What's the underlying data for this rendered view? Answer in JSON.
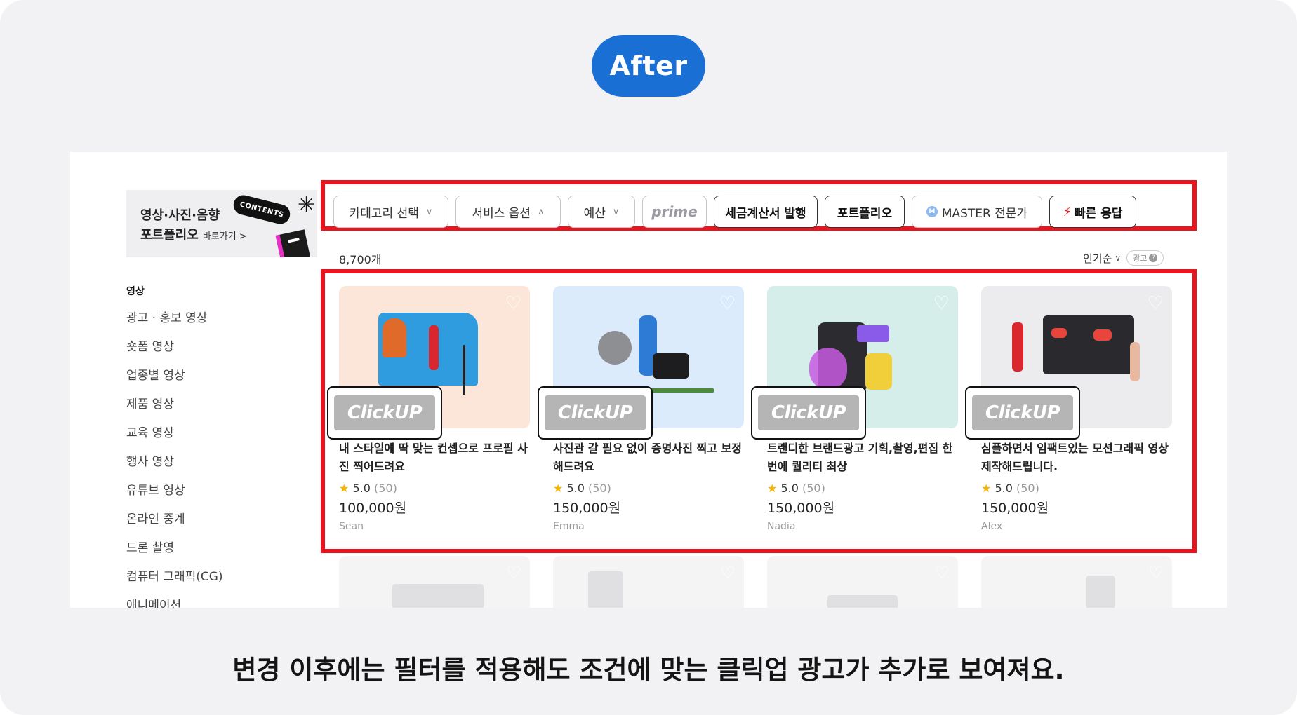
{
  "badge": "After",
  "caption": "변경 이후에는 필터를 적용해도 조건에 맞는 클릭업 광고가 추가로 보여져요.",
  "banner": {
    "line1": "영상·사진·음향",
    "line2": "포트폴리오",
    "link": "바로가기 >",
    "tag": "CONTENTS",
    "asterisk": "✳"
  },
  "sidebar": {
    "heading": "영상",
    "items": [
      "광고 · 홍보 영상",
      "숏폼 영상",
      "업종별 영상",
      "제품 영상",
      "교육 영상",
      "행사 영상",
      "유튜브 영상",
      "온라인 중계",
      "드론 촬영",
      "컴퓨터 그래픽(CG)",
      "애니메이션"
    ]
  },
  "filters": {
    "category": "카테고리 선택",
    "service_options": "서비스 옵션",
    "budget": "예산",
    "prime": "prime",
    "tax_invoice": "세금계산서 발행",
    "portfolio": "포트폴리오",
    "master_badge": "M",
    "master": "MASTER 전문가",
    "fast_response": "빠른 응답",
    "chevron_down": "∨",
    "chevron_up": "∧"
  },
  "results": {
    "count": "8,700개",
    "sort": "인기순",
    "ad_badge": "광고",
    "ad_help": "?"
  },
  "ad_logo": "ClickUP",
  "cards": [
    {
      "title": "내 스타일에 딱 맞는 컨셉으로 프로필 사진 찍어드려요",
      "star": "★",
      "rating": "5.0",
      "reviews": "(50)",
      "price": "100,000원",
      "seller": "Sean",
      "bg": "#fbe6d9"
    },
    {
      "title": "사진관 갈 필요 없이 증명사진 찍고 보정해드려요",
      "star": "★",
      "rating": "5.0",
      "reviews": "(50)",
      "price": "150,000원",
      "seller": "Emma",
      "bg": "#dcebfb"
    },
    {
      "title": "트랜디한 브랜드광고 기획,촬영,편집 한번에 퀄리티 최상",
      "star": "★",
      "rating": "5.0",
      "reviews": "(50)",
      "price": "150,000원",
      "seller": "Nadia",
      "bg": "#d6eeea"
    },
    {
      "title": "심플하면서 임팩트있는 모션그래픽 영상 제작해드립니다.",
      "star": "★",
      "rating": "5.0",
      "reviews": "(50)",
      "price": "150,000원",
      "seller": "Alex",
      "bg": "#ececee"
    }
  ],
  "colors": {
    "accent": "#1a6fd4",
    "highlight": "#e8141e",
    "star": "#f5b400"
  }
}
